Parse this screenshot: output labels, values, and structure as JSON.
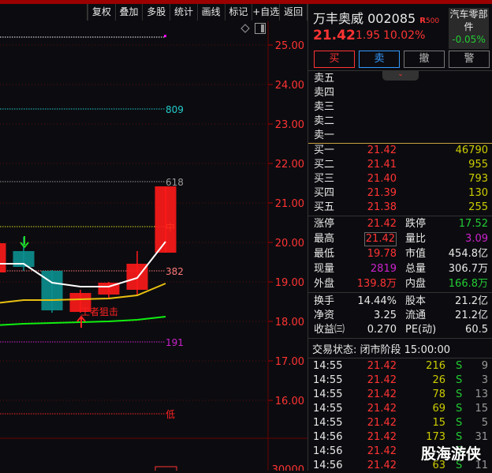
{
  "toolbar": [
    "复权",
    "叠加",
    "多股",
    "统计",
    "画线",
    "标记",
    "+自选",
    "返回"
  ],
  "stock": {
    "name": "万丰奥威",
    "code": "002085",
    "tag": "R",
    "tag2": "500",
    "price": "21.42",
    "change": "1.95",
    "pct": "10.02%",
    "sector": "汽车零部件",
    "sector_pct": "-0.05%"
  },
  "actions": {
    "buy": "买",
    "sell": "卖",
    "cancel": "撤",
    "alert": "警"
  },
  "asks": [
    {
      "label": "卖五"
    },
    {
      "label": "卖四"
    },
    {
      "label": "卖三"
    },
    {
      "label": "卖二"
    },
    {
      "label": "卖一"
    }
  ],
  "bids": [
    {
      "label": "买一",
      "price": "21.42",
      "vol": "46790"
    },
    {
      "label": "买二",
      "price": "21.41",
      "vol": "955"
    },
    {
      "label": "买三",
      "price": "21.40",
      "vol": "793"
    },
    {
      "label": "买四",
      "price": "21.39",
      "vol": "130"
    },
    {
      "label": "买五",
      "price": "21.38",
      "vol": "255"
    }
  ],
  "stats": [
    [
      {
        "k": "涨停",
        "v": "21.42",
        "c": "red"
      },
      {
        "k": "跌停",
        "v": "17.52",
        "c": "grn"
      }
    ],
    [
      {
        "k": "最高",
        "v": "21.42",
        "c": "red"
      },
      {
        "k": "量比",
        "v": "3.09",
        "c": "mag"
      }
    ],
    [
      {
        "k": "最低",
        "v": "19.78",
        "c": "red"
      },
      {
        "k": "市值",
        "v": "454.8亿",
        "c": "wht"
      }
    ],
    [
      {
        "k": "现量",
        "v": "2819",
        "c": "mag"
      },
      {
        "k": "总量",
        "v": "306.7万",
        "c": "wht"
      }
    ],
    [
      {
        "k": "外盘",
        "v": "139.8万",
        "c": "red"
      },
      {
        "k": "内盘",
        "v": "166.8万",
        "c": "grn"
      }
    ]
  ],
  "stats2": [
    [
      {
        "k": "换手",
        "v": "14.44%"
      },
      {
        "k": "股本",
        "v": "21.2亿"
      }
    ],
    [
      {
        "k": "净资",
        "v": "3.25"
      },
      {
        "k": "流通",
        "v": "21.2亿"
      }
    ],
    [
      {
        "k": "收益㈢",
        "v": "0.270"
      },
      {
        "k": "PE(动)",
        "v": "60.5"
      }
    ]
  ],
  "trade_status": "交易状态: 闭市阶段 15:00:00",
  "ticks": [
    {
      "t": "14:55",
      "p": "21.42",
      "v": "216",
      "s": "S",
      "n": "9"
    },
    {
      "t": "14:55",
      "p": "21.42",
      "v": "26",
      "s": "S",
      "n": "3"
    },
    {
      "t": "14:55",
      "p": "21.42",
      "v": "78",
      "s": "S",
      "n": "13"
    },
    {
      "t": "14:55",
      "p": "21.42",
      "v": "69",
      "s": "S",
      "n": "15"
    },
    {
      "t": "14:55",
      "p": "21.42",
      "v": "15",
      "s": "S",
      "n": "5"
    },
    {
      "t": "14:56",
      "p": "21.42",
      "v": "173",
      "s": "S",
      "n": "31"
    },
    {
      "t": "14:56",
      "p": "21.42",
      "v": "",
      "s": "S",
      "n": ""
    },
    {
      "t": "14:56",
      "p": "21.42",
      "v": "63",
      "s": "S",
      "n": "11"
    }
  ],
  "watermark": "股海游侠",
  "chart_data": {
    "axis_labels": [
      "25.00",
      "24.00",
      "23.00",
      "22.00",
      "21.00",
      "20.00",
      "19.00",
      "18.00",
      "17.00",
      "16.00"
    ],
    "vol_label": "30000",
    "candles": [
      {
        "o": 19.24,
        "c": 19.98,
        "h": 19.98,
        "l": 19.24
      },
      {
        "o": 19.78,
        "c": 19.38,
        "h": 20.14,
        "l": 19.28
      },
      {
        "o": 19.28,
        "c": 18.28,
        "h": 19.3,
        "l": 18.22
      },
      {
        "o": 18.24,
        "c": 18.72,
        "h": 18.8,
        "l": 18.22
      },
      {
        "o": 18.68,
        "c": 18.98,
        "h": 19.0,
        "l": 18.6
      },
      {
        "o": 18.8,
        "c": 19.46,
        "h": 19.78,
        "l": 18.68
      },
      {
        "o": 19.74,
        "c": 21.42,
        "h": 21.42,
        "l": 19.74
      }
    ],
    "ma_white": [
      19.46,
      19.46,
      18.98,
      18.88,
      18.88,
      19.1,
      20.02
    ],
    "ma_yellow": [
      18.46,
      18.54,
      18.54,
      18.56,
      18.58,
      18.66,
      18.96
    ],
    "ma_green": [
      17.9,
      17.94,
      17.96,
      17.98,
      18.0,
      18.04,
      18.12
    ],
    "levels": [
      {
        "p": 25.2,
        "label": "",
        "color": "#ffffff"
      },
      {
        "p": 23.38,
        "label": "809",
        "color": "#22cccc"
      },
      {
        "p": 21.54,
        "label": "618",
        "color": "#999999"
      },
      {
        "p": 20.4,
        "label": "中",
        "color": "#dddd22"
      },
      {
        "p": 19.28,
        "label": "382",
        "color": "#ff7777"
      },
      {
        "p": 17.48,
        "label": "191",
        "color": "#cc22cc"
      },
      {
        "p": 15.66,
        "label": "低",
        "color": "#ff2222"
      }
    ],
    "annotation": "王者狙击"
  }
}
